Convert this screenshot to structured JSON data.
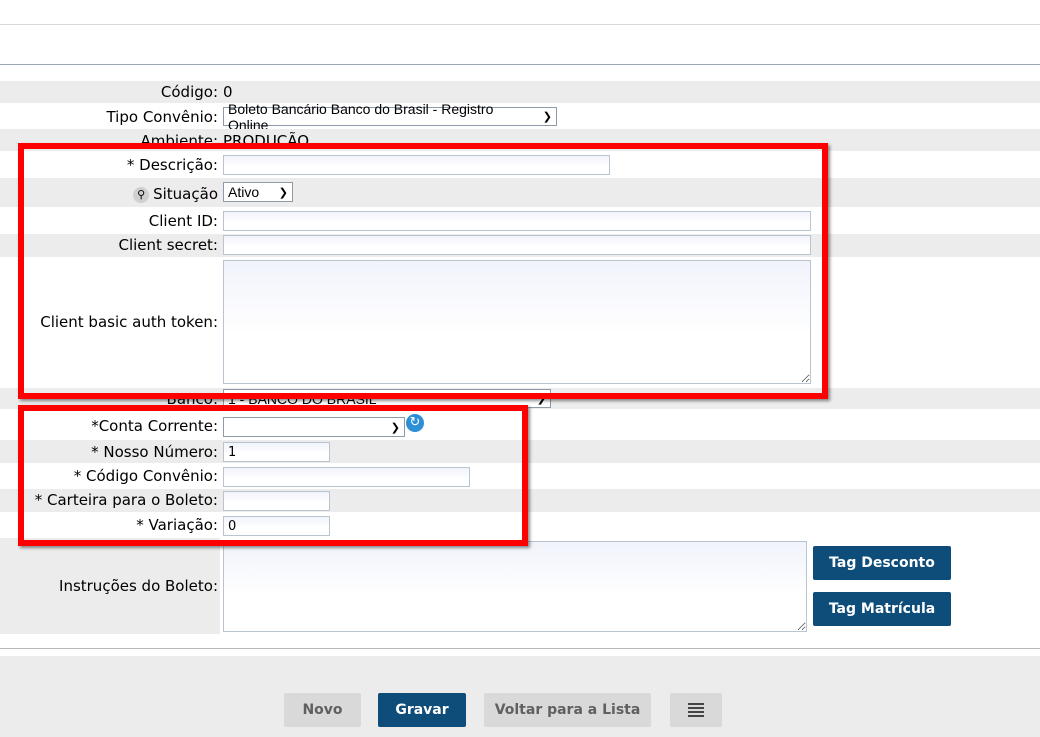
{
  "form": {
    "codigo": {
      "label": "Código:",
      "value": "0"
    },
    "tipo_convenio": {
      "label": "Tipo Convênio:",
      "value": "Boleto Bancário Banco do Brasil - Registro Online"
    },
    "ambiente": {
      "label": "Ambiente:",
      "value": "PRODUÇÃO"
    },
    "descricao": {
      "label": "* Descrição:",
      "value": ""
    },
    "situacao": {
      "label": "Situação",
      "value": "Ativo"
    },
    "client_id": {
      "label": "Client ID:",
      "value": ""
    },
    "client_secret": {
      "label": "Client secret:",
      "value": ""
    },
    "client_basic_auth": {
      "label": "Client basic auth token:",
      "value": ""
    },
    "banco": {
      "label": "Banco:",
      "value": "1 - BANCO DO BRASIL"
    },
    "conta_corrente": {
      "label": "*Conta Corrente:",
      "value": ""
    },
    "nosso_numero": {
      "label": "* Nosso Número:",
      "value": "1"
    },
    "codigo_convenio": {
      "label": "* Código Convênio:",
      "value": ""
    },
    "carteira": {
      "label": "* Carteira para o Boleto:",
      "value": ""
    },
    "variacao": {
      "label": "* Variação:",
      "value": "0"
    },
    "instrucoes": {
      "label": "Instruções do Boleto:",
      "value": ""
    }
  },
  "buttons": {
    "tag_desconto": "Tag Desconto",
    "tag_matricula": "Tag Matrícula",
    "novo": "Novo",
    "gravar": "Gravar",
    "voltar": "Voltar para a Lista"
  },
  "icons": {
    "situacao_icon": "key-icon",
    "refresh_icon": "refresh-icon",
    "list_icon": "list-icon"
  },
  "colors": {
    "primary_button": "#0e4d7a",
    "secondary_button": "#d9d9d9",
    "highlight": "#ff0000"
  }
}
